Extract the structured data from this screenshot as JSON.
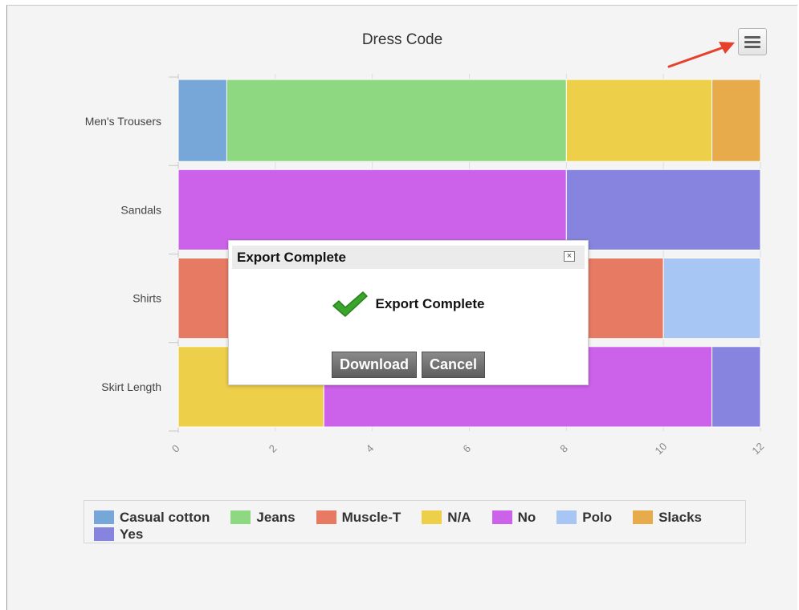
{
  "chart_data": {
    "type": "bar",
    "orientation": "horizontal",
    "stacked": true,
    "title": "Dress Code",
    "categories": [
      "Men's Trousers",
      "Sandals",
      "Shirts",
      "Skirt Length"
    ],
    "series": [
      {
        "name": "Casual cotton",
        "color": "#76a7d8",
        "values": [
          1,
          0,
          0,
          0
        ]
      },
      {
        "name": "Jeans",
        "color": "#8ed882",
        "values": [
          7,
          0,
          0,
          0
        ]
      },
      {
        "name": "Muscle-T",
        "color": "#e67a63",
        "values": [
          0,
          0,
          10,
          0
        ]
      },
      {
        "name": "N/A",
        "color": "#edcf4a",
        "values": [
          3,
          0,
          0,
          3
        ]
      },
      {
        "name": "No",
        "color": "#cc62ea",
        "values": [
          0,
          8,
          0,
          8
        ]
      },
      {
        "name": "Polo",
        "color": "#a8c6f4",
        "values": [
          0,
          0,
          2,
          0
        ]
      },
      {
        "name": "Slacks",
        "color": "#e8ab4b",
        "values": [
          1,
          0,
          0,
          0
        ]
      },
      {
        "name": "Yes",
        "color": "#8784df",
        "values": [
          0,
          4,
          0,
          1
        ]
      }
    ],
    "x_ticks": [
      "0",
      "2",
      "4",
      "6",
      "8",
      "10",
      "12"
    ],
    "xlim": [
      0,
      12
    ],
    "grid": true,
    "legend_position": "bottom"
  },
  "menu": {
    "icon": "hamburger-menu-icon"
  },
  "annotation": {
    "icon": "red-arrow-icon",
    "color": "#e8412b"
  },
  "dialog": {
    "title": "Export Complete",
    "message": "Export Complete",
    "close_label": "×",
    "download_label": "Download",
    "cancel_label": "Cancel",
    "icon": "check-icon"
  }
}
